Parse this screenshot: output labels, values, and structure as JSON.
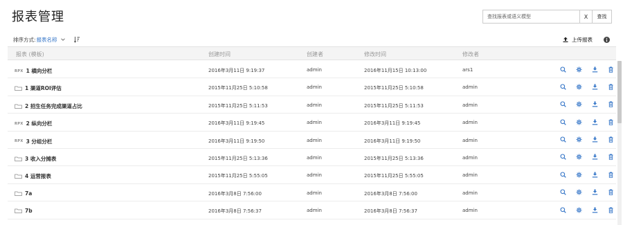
{
  "page": {
    "title": "报表管理"
  },
  "search": {
    "placeholder": "查找报表或语义模型",
    "clear_label": "X",
    "button_label": "查找"
  },
  "toolbar": {
    "sort_label": "排序方式:",
    "sort_value": "报表名称",
    "upload_label": "上传报表"
  },
  "columns": [
    "报表 (模板)",
    "创建时间",
    "创建者",
    "修改时间",
    "修改者"
  ],
  "rows": [
    {
      "type": "RPX",
      "name": "1 横向分栏",
      "created": "2016年3月11日 9:19:37",
      "creator": "admin",
      "modified": "2016年11月15日 10:13:00",
      "modifier": "ars1"
    },
    {
      "type": "folder",
      "name": "1 渠道ROI评估",
      "created": "2015年11月25日 5:10:58",
      "creator": "admin",
      "modified": "2015年11月25日 5:10:58",
      "modifier": "admin"
    },
    {
      "type": "folder",
      "name": "2 招生任务完成渠道占比",
      "created": "2015年11月25日 5:11:53",
      "creator": "admin",
      "modified": "2015年11月25日 5:11:53",
      "modifier": "admin"
    },
    {
      "type": "RPX",
      "name": "2 纵向分栏",
      "created": "2016年3月11日 9:19:45",
      "creator": "admin",
      "modified": "2016年3月11日 9:19:45",
      "modifier": "admin"
    },
    {
      "type": "RPX",
      "name": "3 分组分栏",
      "created": "2016年3月11日 9:19:50",
      "creator": "admin",
      "modified": "2016年3月11日 9:19:50",
      "modifier": "admin"
    },
    {
      "type": "folder",
      "name": "3 收入分摊表",
      "created": "2015年11月25日 5:13:36",
      "creator": "admin",
      "modified": "2015年11月25日 5:13:36",
      "modifier": "admin"
    },
    {
      "type": "folder",
      "name": "4 运营报表",
      "created": "2015年11月25日 5:55:05",
      "creator": "admin",
      "modified": "2015年11月25日 5:55:05",
      "modifier": "admin"
    },
    {
      "type": "folder",
      "name": "7a",
      "created": "2016年3月8日 7:56:00",
      "creator": "admin",
      "modified": "2016年3月8日 7:56:00",
      "modifier": "admin"
    },
    {
      "type": "folder",
      "name": "7b",
      "created": "2016年3月8日 7:56:37",
      "creator": "admin",
      "modified": "2016年3月8日 7:56:37",
      "modifier": "admin"
    }
  ],
  "row_actions": [
    "preview-icon",
    "settings-icon",
    "download-icon",
    "delete-icon"
  ],
  "colors": {
    "accent": "#3777c8",
    "header_bg": "#f4f4f4"
  }
}
